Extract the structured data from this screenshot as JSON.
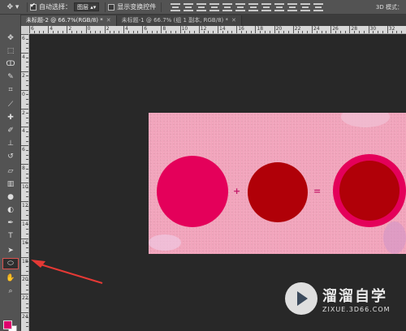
{
  "options_bar": {
    "auto_select_label": "自动选择：",
    "auto_select_checked": true,
    "layer_dropdown": "图层",
    "show_transform_label": "显示变换控件",
    "show_transform_checked": false,
    "mode3d_label": "3D 模式："
  },
  "tabs": [
    {
      "label": "未标题-2 @ 66.7%(RGB/8) *",
      "active": true
    },
    {
      "label": "未标题-1 @ 66.7% (组 1 副本, RGB/8) *",
      "active": false
    }
  ],
  "ruler": {
    "top_labels": [
      "6",
      "4",
      "2",
      "0",
      "2",
      "4",
      "6",
      "8",
      "10",
      "12",
      "14",
      "16",
      "18",
      "20",
      "22",
      "24",
      "26",
      "28",
      "30",
      "32"
    ],
    "left_labels": [
      "6",
      "4",
      "2",
      "0",
      "2",
      "4",
      "6",
      "8",
      "10",
      "12",
      "14",
      "16",
      "18",
      "20",
      "22",
      "24"
    ]
  },
  "tools": [
    {
      "name": "move-tool",
      "icon": "move-icon",
      "glyph": "✥"
    },
    {
      "name": "marquee-tool",
      "icon": "marquee-icon",
      "glyph": "⬚"
    },
    {
      "name": "lasso-tool",
      "icon": "lasso-icon",
      "glyph": "ↀ"
    },
    {
      "name": "quick-select-tool",
      "icon": "magic-wand-icon",
      "glyph": "✎"
    },
    {
      "name": "crop-tool",
      "icon": "crop-icon",
      "glyph": "⌗"
    },
    {
      "name": "eyedropper-tool",
      "icon": "eyedropper-icon",
      "glyph": "⟋"
    },
    {
      "name": "healing-brush-tool",
      "icon": "bandage-icon",
      "glyph": "✚"
    },
    {
      "name": "brush-tool",
      "icon": "brush-icon",
      "glyph": "✐"
    },
    {
      "name": "clone-stamp-tool",
      "icon": "stamp-icon",
      "glyph": "⊥"
    },
    {
      "name": "history-brush-tool",
      "icon": "history-brush-icon",
      "glyph": "↺"
    },
    {
      "name": "eraser-tool",
      "icon": "eraser-icon",
      "glyph": "▱"
    },
    {
      "name": "gradient-tool",
      "icon": "gradient-icon",
      "glyph": "▥"
    },
    {
      "name": "blur-tool",
      "icon": "blur-icon",
      "glyph": "●"
    },
    {
      "name": "dodge-tool",
      "icon": "dodge-icon",
      "glyph": "◐"
    },
    {
      "name": "pen-tool",
      "icon": "pen-icon",
      "glyph": "✒"
    },
    {
      "name": "type-tool",
      "icon": "type-icon",
      "glyph": "T"
    },
    {
      "name": "path-select-tool",
      "icon": "path-select-icon",
      "glyph": "➤"
    },
    {
      "name": "ellipse-tool",
      "icon": "ellipse-icon",
      "glyph": "⬭"
    },
    {
      "name": "hand-tool",
      "icon": "hand-icon",
      "glyph": "✋"
    },
    {
      "name": "zoom-tool",
      "icon": "zoom-icon",
      "glyph": "⌕"
    }
  ],
  "colors": {
    "foreground": "#e0006e",
    "background": "#ffffff",
    "canvas_bg": "#f2a4bc",
    "circle_pink": "#e4005a",
    "circle_red": "#b00008",
    "annotation_arrow": "#e53935"
  },
  "canvas": {
    "plus_sign": "+",
    "equals_sign": "="
  },
  "watermark": {
    "title": "溜溜自学",
    "subtitle": "ZIXUE.3D66.COM"
  }
}
